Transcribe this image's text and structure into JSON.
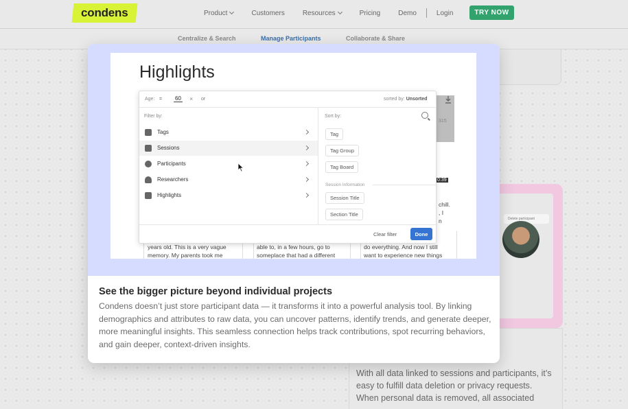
{
  "nav": {
    "logo": "condens",
    "links": [
      {
        "label": "Product",
        "has_dropdown": true
      },
      {
        "label": "Customers",
        "has_dropdown": false
      },
      {
        "label": "Resources",
        "has_dropdown": true
      },
      {
        "label": "Pricing",
        "has_dropdown": false
      },
      {
        "label": "Demo",
        "has_dropdown": false
      }
    ],
    "login": "Login",
    "cta": "TRY NOW",
    "cta_color": "#33a36d",
    "logo_color": "#d8f235"
  },
  "subnav": {
    "items": [
      "Centralize & Search",
      "Manage Participants",
      "Collaborate & Share"
    ],
    "active": "Manage Participants"
  },
  "screenshot": {
    "title": "Highlights",
    "filter_bar": {
      "field": "Age:",
      "operator": "=",
      "value": "60",
      "joiner": "or",
      "sorted_prefix": "sorted by:",
      "sorted_value": "Unsorted"
    },
    "filter_by_label": "Filter by:",
    "filters": [
      {
        "label": "Tags",
        "icon": "tag-icon"
      },
      {
        "label": "Sessions",
        "icon": "sessions-icon"
      },
      {
        "label": "Participants",
        "icon": "participants-icon"
      },
      {
        "label": "Researchers",
        "icon": "researcher-icon"
      },
      {
        "label": "Highlights",
        "icon": "highlight-icon"
      }
    ],
    "sort_by_label": "Sort by:",
    "sort_options": [
      "Tag",
      "Tag Group",
      "Tag Board"
    ],
    "section_info_label": "Session Information",
    "section_options": [
      "Session Title",
      "Section Title"
    ],
    "clear_filter": "Clear filter",
    "done": "Done",
    "count": "315",
    "timestamp": "0:39",
    "snippets": {
      "col1": [
        "years old. This is a very vague",
        "memory. My parents took me"
      ],
      "col2": [
        "able to, in a few hours, go to",
        "someplace that had a different"
      ],
      "col3": [
        "do everything. And now I still",
        "want to experience new things"
      ],
      "right1": "chill.",
      "right2": ", I",
      "right3": "n"
    }
  },
  "modal": {
    "heading": "See the bigger picture beyond individual projects",
    "body": "Condens doesn’t just store participant data — it transforms it into a powerful analysis tool. By linking demographics and attributes to raw data, you can uncover patterns, identify trends, and generate deeper, more meaningful insights. This seamless connection helps track contributions, spot recurring behaviors, and gain deeper, context-driven insights."
  },
  "background": {
    "delete_chip": "Delete participant",
    "bottom_text": "With all data linked to sessions and participants, it’s easy to fulfill data deletion or privacy requests. When personal data is removed, all associated",
    "pink_accent": "#f1c8e0",
    "modal_media_bg": "#d6dcff",
    "done_color": "#3574d2"
  }
}
